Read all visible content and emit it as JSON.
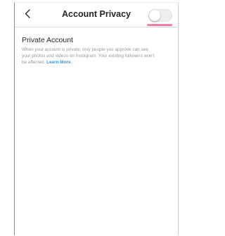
{
  "header": {
    "back_icon": "chevron-left-icon",
    "title": "Account Privacy"
  },
  "private_account": {
    "label": "Private Account",
    "description": "When your account is private, only people you approve can see your photos and videos on Instagram. Your existing followers won't be affected.",
    "learn_more": "Learn More.",
    "enabled": false
  },
  "colors": {
    "link": "#3897f0",
    "highlight": "#f07ea7",
    "text": "#262626",
    "secondary_text": "#9a9a9a"
  }
}
